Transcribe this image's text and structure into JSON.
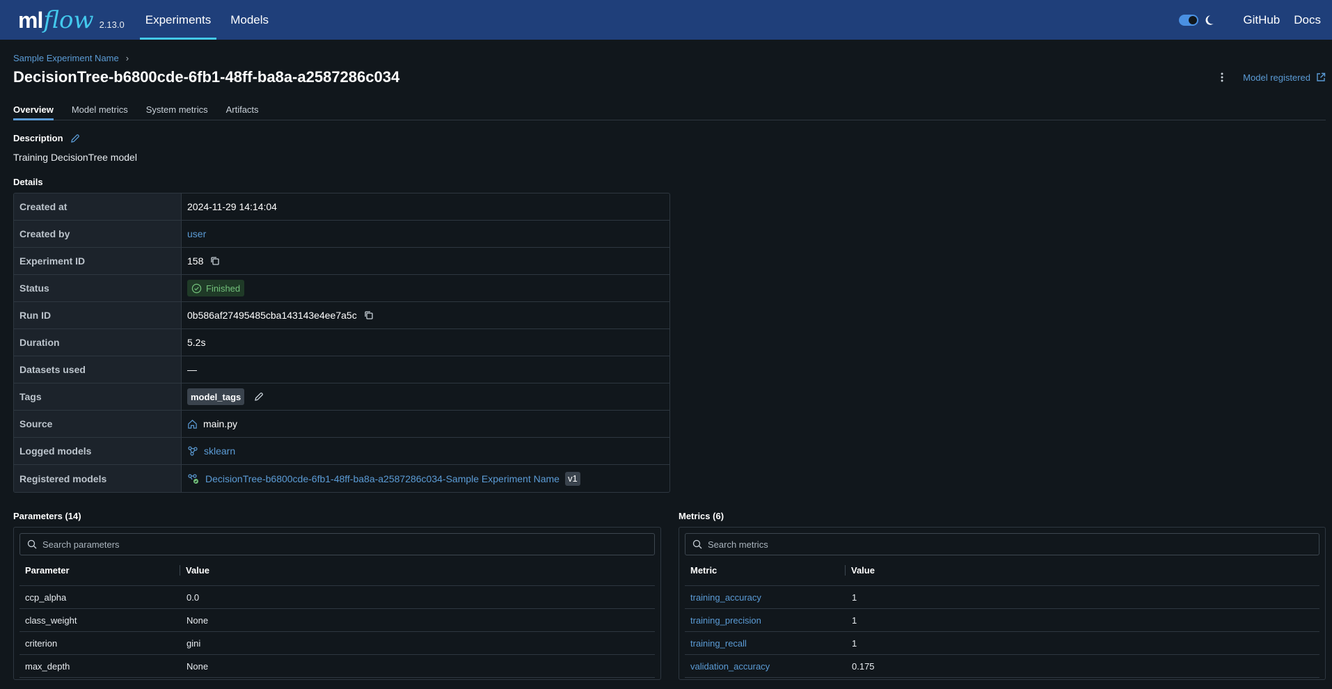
{
  "header": {
    "logo_ml": "ml",
    "logo_flow": "flow",
    "version": "2.13.0",
    "nav": [
      {
        "label": "Experiments",
        "active": true
      },
      {
        "label": "Models",
        "active": false
      }
    ],
    "github": "GitHub",
    "docs": "Docs",
    "accent_color": "#43c9ed",
    "bar_color": "#1f3f7a"
  },
  "breadcrumb": {
    "experiment": "Sample Experiment Name",
    "separator": "›"
  },
  "run": {
    "title": "DecisionTree-b6800cde-6fb1-48ff-ba8a-a2587286c034",
    "model_registered": "Model registered"
  },
  "tabs": [
    {
      "label": "Overview",
      "active": true
    },
    {
      "label": "Model metrics",
      "active": false
    },
    {
      "label": "System metrics",
      "active": false
    },
    {
      "label": "Artifacts",
      "active": false
    }
  ],
  "description": {
    "label": "Description",
    "text": "Training DecisionTree model"
  },
  "details": {
    "label": "Details",
    "created_at": {
      "key": "Created at",
      "value": "2024-11-29 14:14:04"
    },
    "created_by": {
      "key": "Created by",
      "value": "user"
    },
    "experiment_id": {
      "key": "Experiment ID",
      "value": "158"
    },
    "status": {
      "key": "Status",
      "value": "Finished",
      "color": "#73c17b"
    },
    "run_id": {
      "key": "Run ID",
      "value": "0b586af27495485cba143143e4ee7a5c"
    },
    "duration": {
      "key": "Duration",
      "value": "5.2s"
    },
    "datasets_used": {
      "key": "Datasets used",
      "value": "—"
    },
    "tags": {
      "key": "Tags",
      "value": "model_tags"
    },
    "source": {
      "key": "Source",
      "value": "main.py"
    },
    "logged_models": {
      "key": "Logged models",
      "value": "sklearn"
    },
    "registered_models": {
      "key": "Registered models",
      "value": "DecisionTree-b6800cde-6fb1-48ff-ba8a-a2587286c034-Sample Experiment Name",
      "version": "v1"
    }
  },
  "parameters": {
    "title": "Parameters (14)",
    "search_placeholder": "Search parameters",
    "col_name": "Parameter",
    "col_value": "Value",
    "rows": [
      {
        "name": "ccp_alpha",
        "value": "0.0"
      },
      {
        "name": "class_weight",
        "value": "None"
      },
      {
        "name": "criterion",
        "value": "gini"
      },
      {
        "name": "max_depth",
        "value": "None"
      }
    ]
  },
  "metrics": {
    "title": "Metrics (6)",
    "search_placeholder": "Search metrics",
    "col_name": "Metric",
    "col_value": "Value",
    "rows": [
      {
        "name": "training_accuracy",
        "value": "1"
      },
      {
        "name": "training_precision",
        "value": "1"
      },
      {
        "name": "training_recall",
        "value": "1"
      },
      {
        "name": "validation_accuracy",
        "value": "0.175"
      }
    ]
  }
}
